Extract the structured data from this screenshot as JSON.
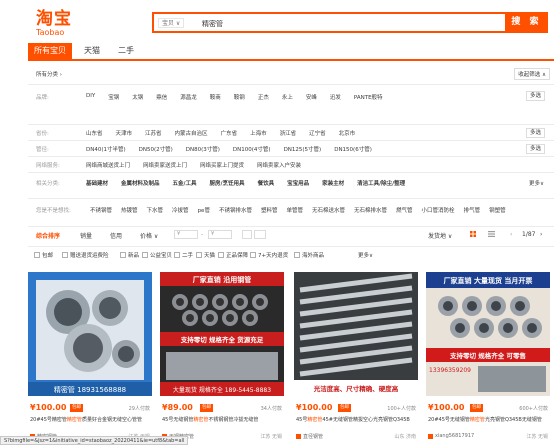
{
  "logo": {
    "cn": "淘宝",
    "en": "Taobao"
  },
  "search": {
    "scope": "宝贝 ∨",
    "query": "精密管",
    "button": "搜 索"
  },
  "tabs": [
    "所有宝贝",
    "天猫",
    "二手"
  ],
  "crumb": "所有分类 ›",
  "collapse_label": "收起筛选 ∧",
  "filters": {
    "brand": {
      "label": "品牌:",
      "values": [
        "DIY",
        "宝钢",
        "太钢",
        "鼎信",
        "源昌龙",
        "鞍商",
        "鞍钢",
        "正杰",
        "永上",
        "安峰",
        "迅发",
        "PANTE般特"
      ],
      "more": "多选"
    },
    "location": {
      "label": "省份:",
      "values": [
        "山东省",
        "天津市",
        "江苏省",
        "内蒙古自治区",
        "广东省",
        "上海市",
        "浙江省",
        "辽宁省",
        "北京市"
      ],
      "more": "多选"
    },
    "pipe_size": {
      "label": "管径:",
      "values": [
        "DN40(1寸半管)",
        "DN50(2寸管)",
        "DN80(3寸管)",
        "DN100(4寸管)",
        "DN125(5寸管)",
        "DN150(6寸管)"
      ],
      "more": "多选"
    },
    "service": {
      "label": "网络服务:",
      "values": [
        "网络商城送货上门",
        "网络卖家送货上门",
        "网络买家上门提货",
        "网络卖家入户安装"
      ]
    },
    "related": {
      "label": "相关分类:",
      "values": [
        "基础建材",
        "金属材料及制品",
        "五金/工具",
        "厨房/烹饪用具",
        "餐饮具",
        "宝宝用品",
        "家装主材",
        "清洁工具/除尘/整理"
      ],
      "more": "更多∨"
    },
    "other": {
      "label": "您是不是想找:",
      "values": [
        "不锈钢管",
        "热镀管",
        "下水管",
        "冷拔管",
        "pe管",
        "不锈钢排水管",
        "塑料管",
        "单管管",
        "无石棉送水管",
        "无石棉排水管",
        "燃气管",
        "小口管消防栓",
        "排气管",
        "钢塑管"
      ]
    }
  },
  "sort": {
    "items": [
      "综合排序",
      "销量",
      "信用",
      "价格 ∨"
    ],
    "price_min": "¥",
    "price_max": "¥",
    "ship_from": "发货地 ∨",
    "pager": "1/87"
  },
  "options": [
    "包邮",
    "赠送退货运费险",
    "新品",
    "公益宝贝",
    "二手",
    "天猫",
    "正品保障",
    "7+天内退货",
    "海外商品",
    "更多∨"
  ],
  "products": [
    {
      "price": "¥100.00",
      "badge": "包邮",
      "sold": "29人付款",
      "title_pre": "20#45号精密管",
      "title_hl": "精密管",
      "title_post": "质量好合金钢无缝空心管管",
      "shop": "精密钢管",
      "loc": "江苏 无锡"
    },
    {
      "price": "¥89.00",
      "badge": "包邮",
      "sold": "34人付款",
      "title_pre": "45号无缝钢管",
      "title_hl": "精密管",
      "title_post": "不锈钢钢管冷拔无缝管",
      "shop": "天钢精密管",
      "loc": "江苏 无锡"
    },
    {
      "price": "¥100.00",
      "badge": "包邮",
      "sold": "100+人付款",
      "title_pre": "45号",
      "title_hl": "精密管",
      "title_post": "45#无缝钢管精拔空心光亮钢管Q345B",
      "shop": "直径钢管",
      "loc": "山东 济南"
    },
    {
      "price": "¥100.00",
      "badge": "包邮",
      "sold": "600+人付款",
      "title_pre": "20#45号无缝钢管",
      "title_hl": "精密管",
      "title_post": "光亮钢管Q345B无缝钢管",
      "shop": "xiang56817917",
      "loc": "江苏 无锡"
    }
  ],
  "image_text": {
    "p1": "精密管 18931568888",
    "p2_top": "厂家直销 沿用钢管",
    "p2_mid": "支持零切 规格齐全 货源充足",
    "p2_bot": "大量现货 规格齐全 189-5445-8883",
    "p3": "光洁度高、尺寸精确、硬度高",
    "p4_top": "厂家直销 大量现货 当月开票",
    "p4_mid": "支持零切 规格齐全 可零售",
    "p4_phone": "13396359209"
  },
  "statusbar": "S?bimgfile=&jsz=1&initiative_id=staobaoz_20220411&ie=utf8&tab=all"
}
